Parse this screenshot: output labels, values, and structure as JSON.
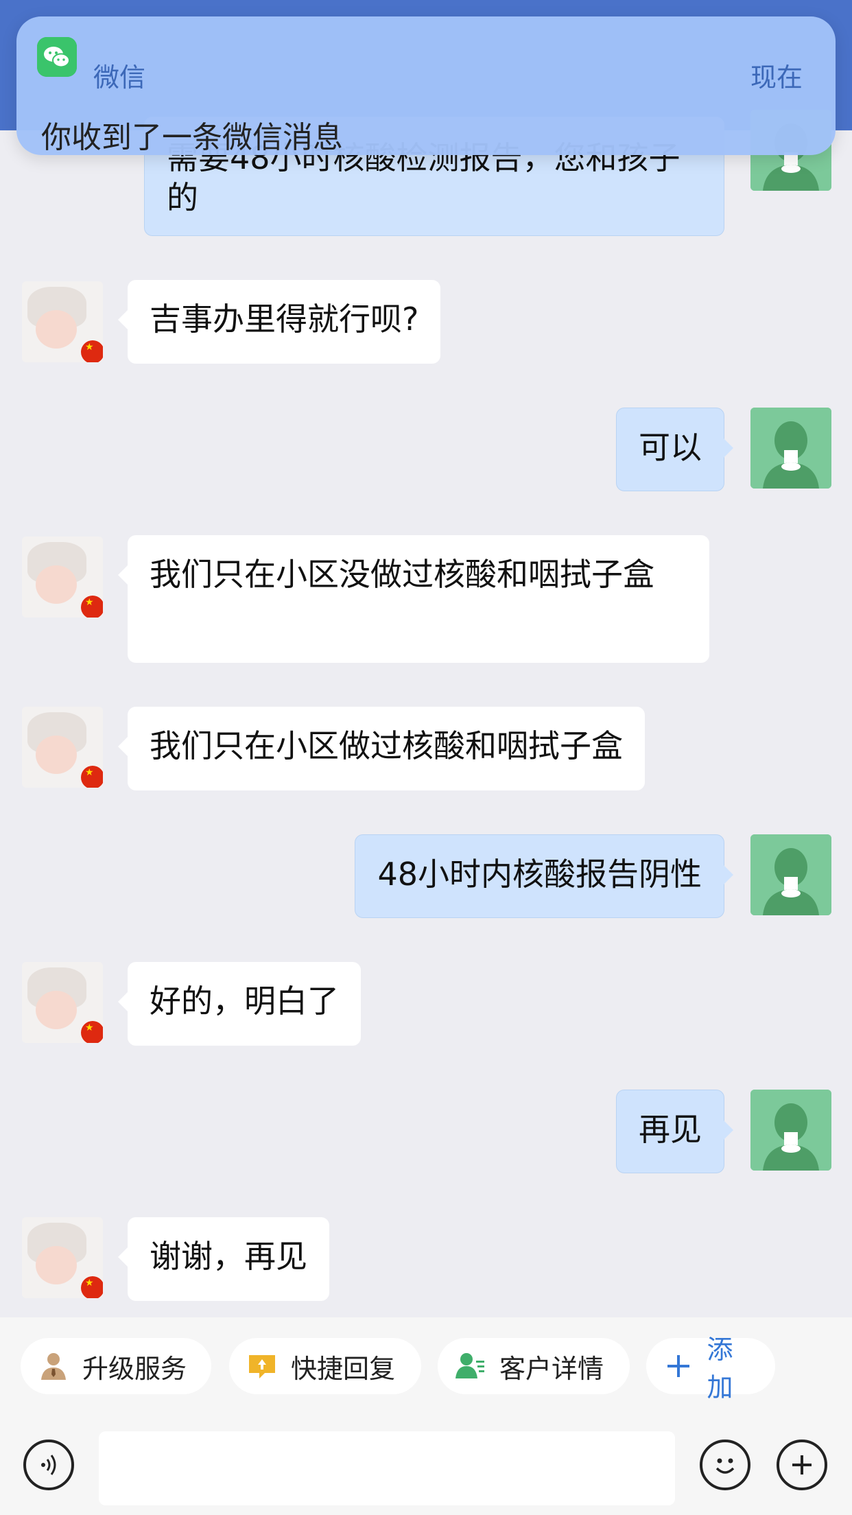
{
  "notification": {
    "app_name": "微信",
    "time": "现在",
    "message": "你收到了一条微信消息"
  },
  "messages": [
    {
      "side": "mine",
      "text": "需要48小时核酸检测报告，您和孩子的"
    },
    {
      "side": "theirs",
      "text": "吉事办里得就行呗?"
    },
    {
      "side": "mine",
      "text": "可以"
    },
    {
      "side": "theirs",
      "text": "我们只在小区没做过核酸和咽拭子盒"
    },
    {
      "side": "theirs",
      "text": "我们只在小区做过核酸和咽拭子盒"
    },
    {
      "side": "mine",
      "text": "48小时内核酸报告阴性"
    },
    {
      "side": "theirs",
      "text": "好的，明白了"
    },
    {
      "side": "mine",
      "text": "再见"
    },
    {
      "side": "theirs",
      "text": "谢谢，再见"
    }
  ],
  "quick_actions": [
    {
      "label": "升级服务",
      "icon": "person-tie-icon"
    },
    {
      "label": "快捷回复",
      "icon": "quick-reply-icon"
    },
    {
      "label": "客户详情",
      "icon": "customer-detail-icon"
    },
    {
      "label": "添加",
      "icon": "plus-icon"
    }
  ],
  "input": {
    "voice_icon": "voice-icon",
    "emoji_icon": "emoji-icon",
    "more_icon": "plus-circle-icon"
  },
  "colors": {
    "header": "#4a72c9",
    "mine_bubble": "#cfe3fd",
    "theirs_bubble": "#ffffff",
    "accent": "#3477d6"
  }
}
